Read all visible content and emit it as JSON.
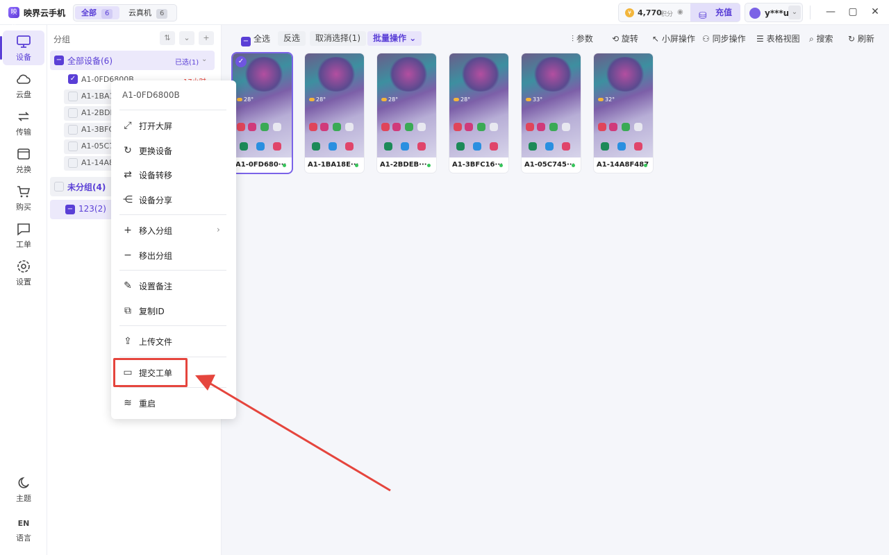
{
  "titlebar": {
    "logo_text": "映界",
    "app_name": "映界云手机",
    "tabs": [
      {
        "label": "全部",
        "count": "6"
      },
      {
        "label": "云真机",
        "count": "6"
      }
    ],
    "points_value": "4,770",
    "points_label": "积分",
    "recharge_label": "充值",
    "username": "y***u"
  },
  "nav": {
    "items": [
      {
        "label": "设备",
        "icon": "monitor-icon"
      },
      {
        "label": "云盘",
        "icon": "cloud-icon"
      },
      {
        "label": "传输",
        "icon": "transfer-icon"
      },
      {
        "label": "兑换",
        "icon": "ticket-icon"
      },
      {
        "label": "购买",
        "icon": "cart-icon"
      },
      {
        "label": "工单",
        "icon": "message-icon"
      },
      {
        "label": "设置",
        "icon": "gear-icon"
      }
    ],
    "theme_label": "主题",
    "lang_code": "EN",
    "lang_label": "语言"
  },
  "groups": {
    "title": "分组",
    "all_devices": "全部设备(6)",
    "selected_badge": "已选(1)",
    "devices": [
      "A1-0FD6800B",
      "A1-1BA1",
      "A1-2BDE",
      "A1-3BFC",
      "A1-05C7",
      "A1-14A8"
    ],
    "device_tag": "17小时",
    "ungrouped": "未分组(4)",
    "group_123": "123(2)"
  },
  "toolbar": {
    "select_all": "全选",
    "invert": "反选",
    "cancel_selection": "取消选择(1)",
    "batch": "批量操作",
    "params": "参数",
    "rotate": "旋转",
    "small_screen": "小屏操作",
    "sync": "同步操作",
    "table_view": "表格视图",
    "search": "搜索",
    "refresh": "刷新"
  },
  "devices": [
    {
      "label": "A1-0FD680···",
      "weather": "28°",
      "selected": true
    },
    {
      "label": "A1-1BA18E···",
      "weather": "28°",
      "selected": false
    },
    {
      "label": "A1-2BDEB···",
      "weather": "28°",
      "selected": false
    },
    {
      "label": "A1-3BFC16···",
      "weather": "28°",
      "selected": false
    },
    {
      "label": "A1-05C745···",
      "weather": "33°",
      "selected": false
    },
    {
      "label": "A1-14A8F487",
      "weather": "32°",
      "selected": false
    }
  ],
  "context_menu": {
    "title": "A1-0FD6800B",
    "items": [
      {
        "label": "打开大屏",
        "icon": "expand-icon"
      },
      {
        "label": "更换设备",
        "icon": "refresh-icon"
      },
      {
        "label": "设备转移",
        "icon": "swap-icon"
      },
      {
        "label": "设备分享",
        "icon": "share-icon"
      },
      {
        "label": "移入分组",
        "icon": "plus-icon"
      },
      {
        "label": "移出分组",
        "icon": "minus-icon"
      },
      {
        "label": "设置备注",
        "icon": "edit-icon"
      },
      {
        "label": "复制ID",
        "icon": "copy-icon"
      },
      {
        "label": "上传文件",
        "icon": "upload-icon"
      },
      {
        "label": "提交工单",
        "icon": "message-icon"
      },
      {
        "label": "重启",
        "icon": "layers-icon"
      }
    ]
  },
  "colors": {
    "accent": "#5a3fd6",
    "highlight": "#e5453d",
    "online": "#36c55a"
  }
}
